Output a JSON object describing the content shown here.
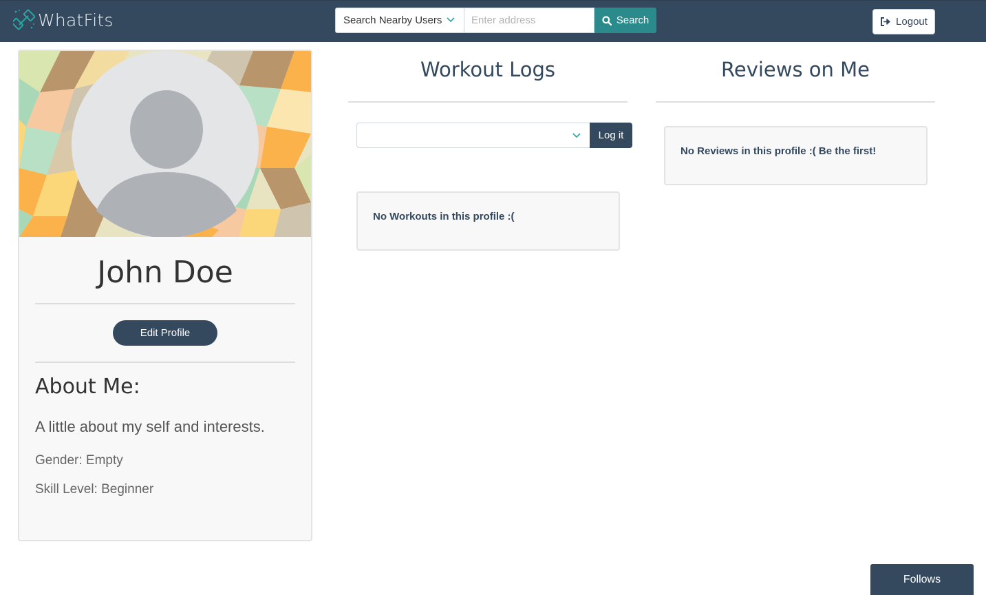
{
  "header": {
    "brand": "WhatFits",
    "search_mode": "Search Nearby Users",
    "address_placeholder": "Enter address",
    "search_label": "Search",
    "logout_label": "Logout"
  },
  "profile": {
    "name": "John Doe",
    "edit_label": "Edit Profile",
    "about_title": "About Me:",
    "about_text": "A little about my self and interests.",
    "gender": "Gender: Empty",
    "skill": "Skill Level: Beginner"
  },
  "workouts": {
    "title": "Workout Logs",
    "select_value": "",
    "log_label": "Log it",
    "empty_text": "No Workouts in this profile :("
  },
  "reviews": {
    "title": "Reviews on Me",
    "empty_text": "No Reviews in this profile :( Be the first!"
  },
  "footer": {
    "follows_label": "Follows"
  },
  "colors": {
    "navbar": "#34495e",
    "accent_teal": "#2a8a8c",
    "card_bg": "#f8f8f8"
  },
  "icons": {
    "brand": "dumbbell-icon",
    "search": "search-icon",
    "logout": "sign-out-icon",
    "dropdown": "chevron-down-icon",
    "avatar": "default-avatar-icon"
  }
}
